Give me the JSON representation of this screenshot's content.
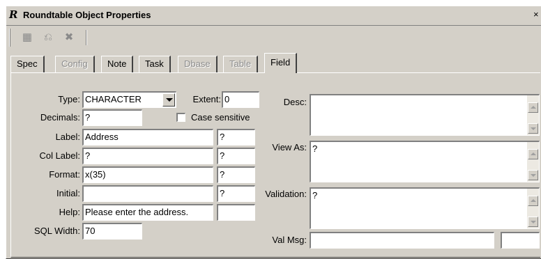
{
  "window": {
    "logo": "R",
    "title": "Roundtable Object Properties",
    "close": "×"
  },
  "toolbar": {
    "buttons": [
      {
        "icon": "grid-save-icon",
        "glyph": "▦"
      },
      {
        "icon": "undo-icon",
        "glyph": "⎌"
      },
      {
        "icon": "delete-icon",
        "glyph": "✖"
      }
    ]
  },
  "tabs": [
    {
      "label": "Spec",
      "state": "normal"
    },
    {
      "label": "Config",
      "state": "disabled"
    },
    {
      "label": "Note",
      "state": "normal"
    },
    {
      "label": "Task",
      "state": "normal"
    },
    {
      "label": "Dbase",
      "state": "disabled"
    },
    {
      "label": "Table",
      "state": "disabled"
    },
    {
      "label": "Field",
      "state": "active"
    }
  ],
  "field": {
    "type": {
      "label": "Type:",
      "value": "CHARACTER"
    },
    "extent": {
      "label": "Extent:",
      "value": "0"
    },
    "decimals": {
      "label": "Decimals:",
      "value": "?"
    },
    "case_sensitive": {
      "label": "Case sensitive",
      "checked": false
    },
    "label": {
      "label": "Label:",
      "value": "Address",
      "sa": "?"
    },
    "col_label": {
      "label": "Col Label:",
      "value": "?",
      "sa": "?"
    },
    "format": {
      "label": "Format:",
      "value": "x(35)",
      "sa": "?"
    },
    "initial": {
      "label": "Initial:",
      "value": "",
      "sa": "?"
    },
    "help": {
      "label": "Help:",
      "value": "Please enter the address.",
      "sa": ""
    },
    "sql_width": {
      "label": "SQL Width:",
      "value": "70"
    },
    "desc": {
      "label": "Desc:",
      "value": ""
    },
    "view_as": {
      "label": "View As:",
      "value": "?"
    },
    "validation": {
      "label": "Validation:",
      "value": "?"
    },
    "val_msg": {
      "label": "Val Msg:",
      "value": "",
      "sa": ""
    }
  }
}
